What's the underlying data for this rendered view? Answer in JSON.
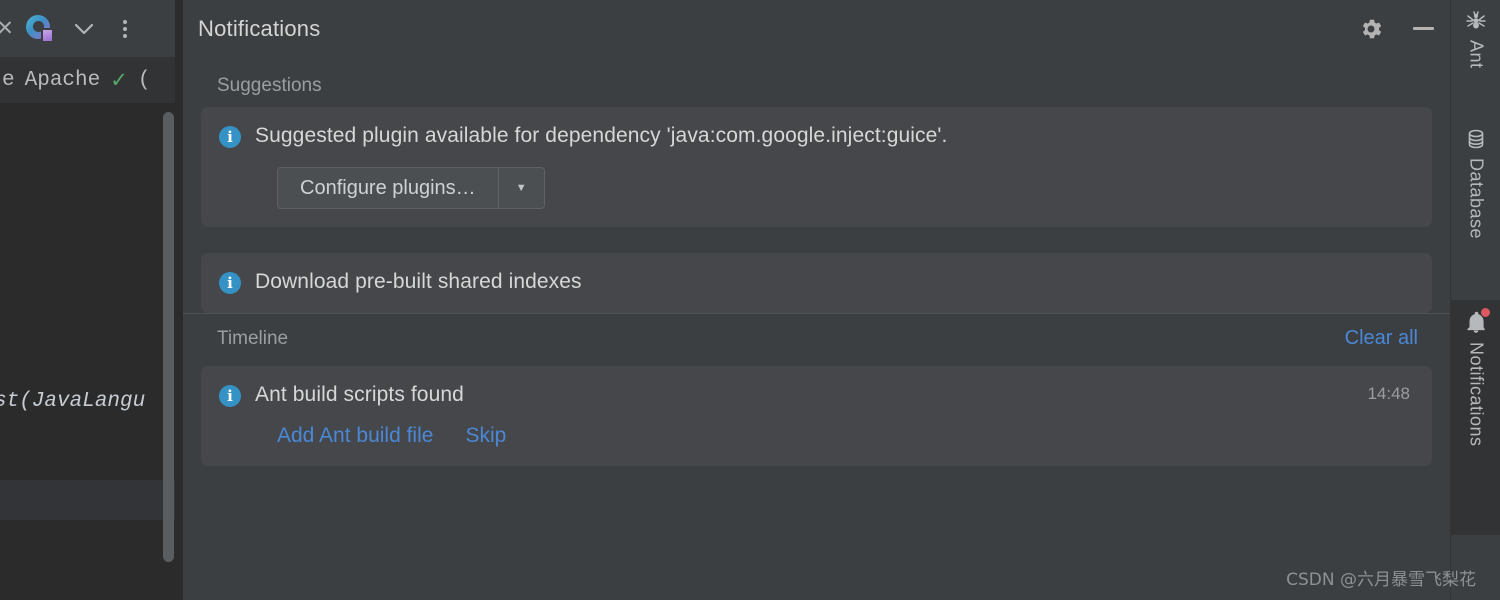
{
  "editor": {
    "toolbar": {
      "close_icon": "close-icon",
      "logo_icon": "intellij-logo-icon",
      "chevron_icon": "chevron-down-icon",
      "more_icon": "more-vertical-icon"
    },
    "breadcrumb": {
      "prefix_fragment": "e",
      "label": "Apache",
      "status_icon": "check-mark-icon",
      "suffix_fragment": "("
    },
    "code_fragment": "st(JavaLangu"
  },
  "notifications_panel": {
    "title": "Notifications",
    "header_buttons": [
      {
        "name": "settings-button",
        "icon": "gear-icon"
      },
      {
        "name": "minimize-button",
        "icon": "minimize-icon"
      }
    ],
    "sections": [
      {
        "label": "Suggestions",
        "cards": [
          {
            "icon": "info-icon",
            "title": "Suggested plugin available for dependency 'java:com.google.inject:guice'.",
            "button": {
              "label": "Configure plugins…",
              "dropdown_icon": "caret-down-icon"
            }
          },
          {
            "icon": "info-icon",
            "title": "Download pre-built shared indexes"
          }
        ]
      },
      {
        "label": "Timeline",
        "action": {
          "label": "Clear all"
        },
        "cards": [
          {
            "icon": "info-icon",
            "title": "Ant build scripts found",
            "time": "14:48",
            "links": [
              "Add Ant build file",
              "Skip"
            ]
          }
        ]
      }
    ]
  },
  "right_stripe": {
    "items": [
      {
        "label": "Ant",
        "icon": "ant-icon"
      },
      {
        "label": "Database",
        "icon": "database-icon"
      },
      {
        "label": "Notifications",
        "icon": "bell-icon",
        "has_badge": true
      }
    ]
  },
  "watermark": {
    "text": "CSDN @六月暴雪飞梨花"
  },
  "colors": {
    "panel_bg": "#3c3f41",
    "card_bg": "#46474b",
    "editor_bg": "#2b2b2b",
    "link_blue": "#4a88d6",
    "info_blue": "#3592c4",
    "check_green": "#59a869",
    "badge_red": "#db5860",
    "text_primary": "#d7d7d7",
    "text_muted": "#9b9ea1"
  }
}
